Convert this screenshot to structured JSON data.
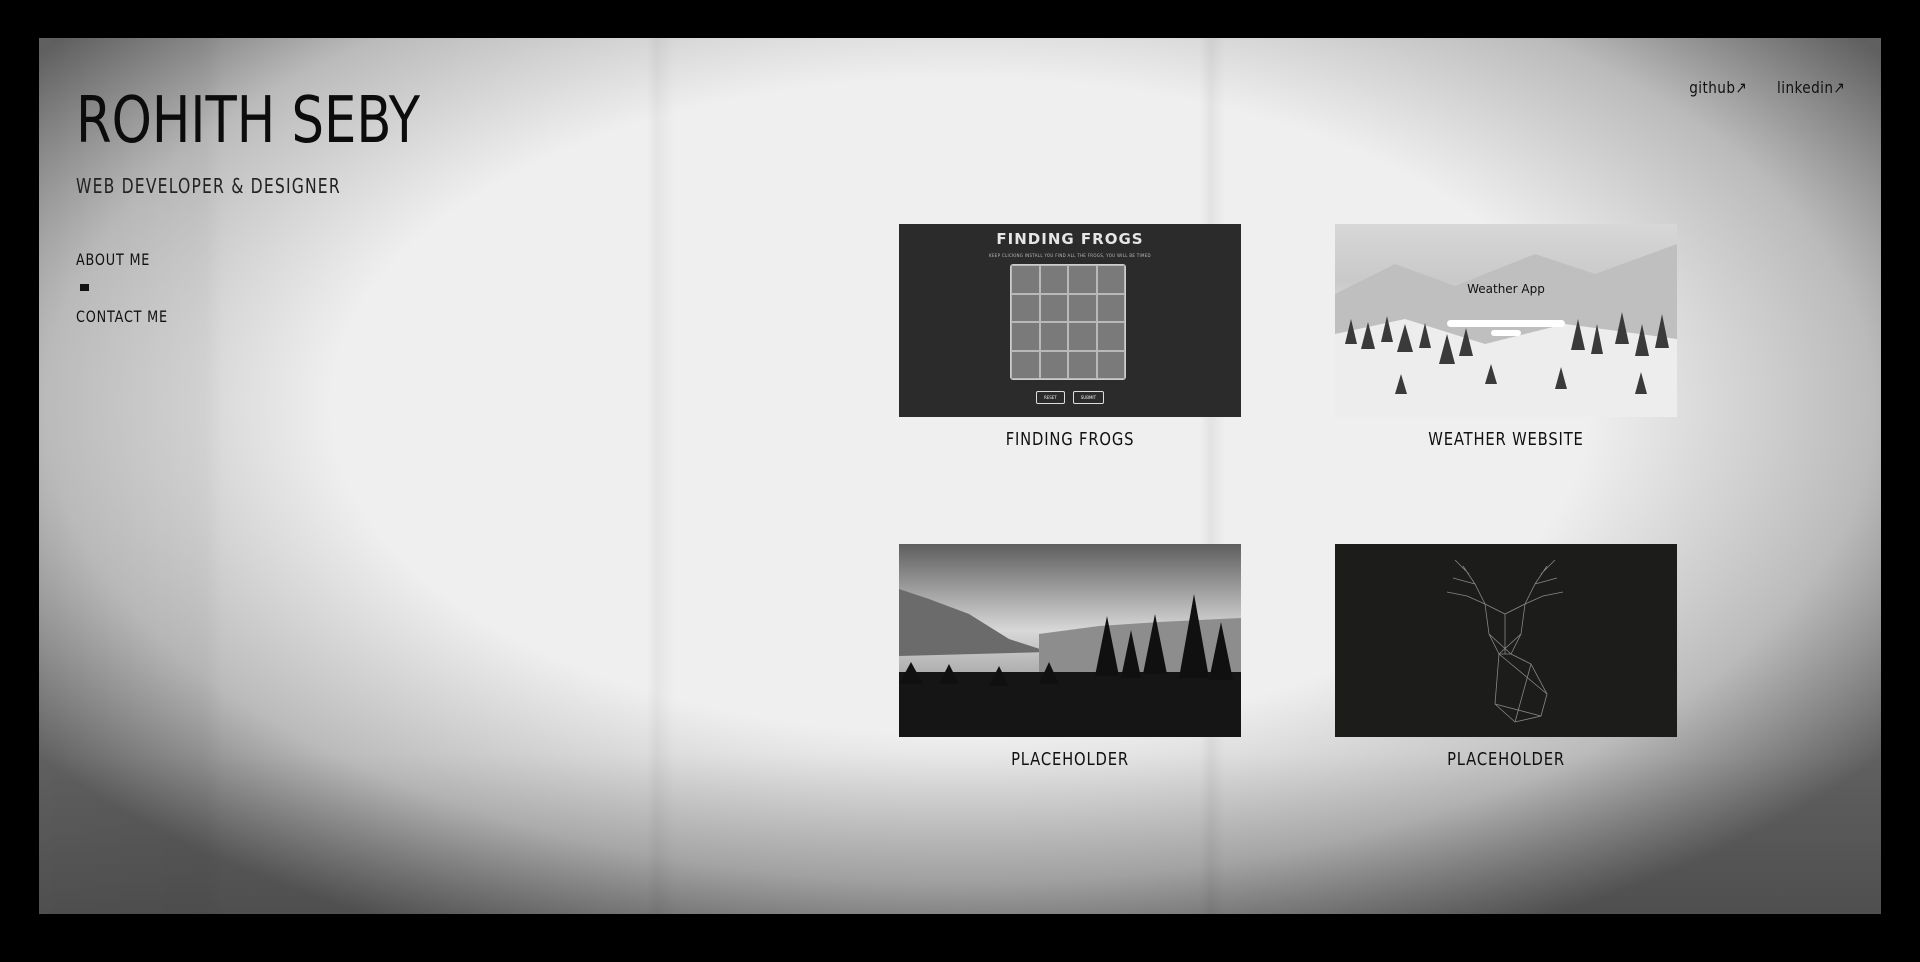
{
  "header": {
    "name": "ROHITH SEBY",
    "tagline": "WEB DEVELOPER & DESIGNER"
  },
  "nav": {
    "items": [
      {
        "label": "ABOUT ME"
      },
      {
        "label": "CONTACT ME"
      }
    ]
  },
  "social": {
    "links": [
      {
        "label": "github↗"
      },
      {
        "label": "linkedin↗"
      }
    ]
  },
  "projects": [
    {
      "label": "FINDING FROGS",
      "thumb_title": "FINDING FROGS",
      "thumb_subtitle": "KEEP CLICKING INSTALL YOU FIND ALL THE FROGS, YOU WILL BE TIMED",
      "thumb_buttons": [
        "RESET",
        "SUBMIT"
      ]
    },
    {
      "label": "WEATHER WEBSITE",
      "thumb_title": "Weather App"
    },
    {
      "label": "PLACEHOLDER"
    },
    {
      "label": "PLACEHOLDER"
    }
  ],
  "colors": {
    "frame_border": "#000000",
    "background": "#efefef",
    "text": "#111111"
  }
}
